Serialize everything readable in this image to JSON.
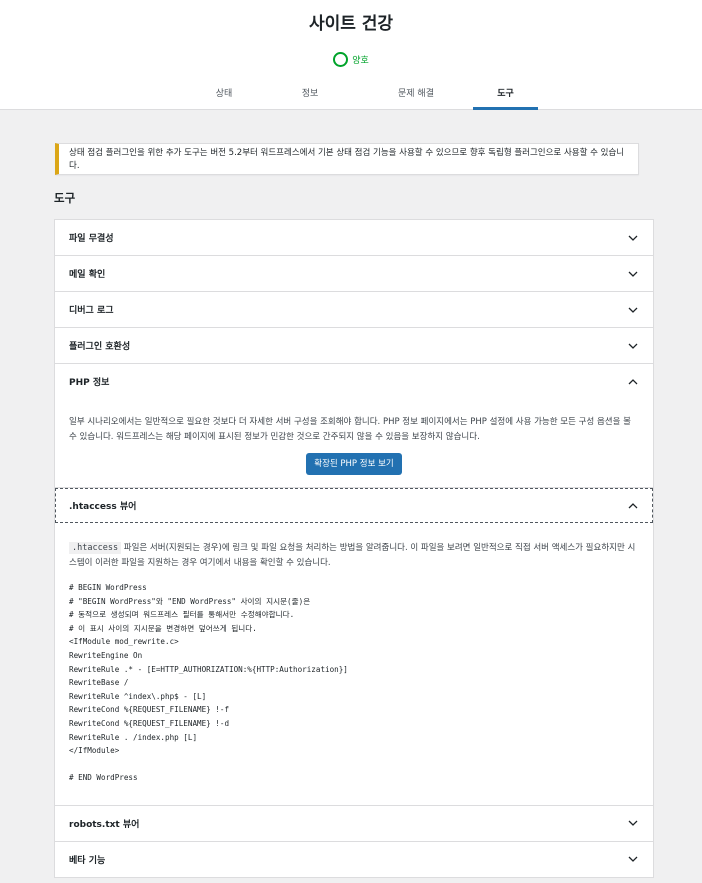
{
  "page": {
    "title": "사이트 건강",
    "status_label": "양호"
  },
  "tabs": [
    {
      "label": "상태"
    },
    {
      "label": "정보"
    },
    {
      "label": "문제 해결"
    },
    {
      "label": "도구"
    }
  ],
  "notice": {
    "text": "상태 점검 플러그인을 위한 추가 도구는 버전 5.2부터 워드프레스에서 기본 상태 점검 기능을 사용할 수 있으므로 향후 독립형 플러그인으로 사용할 수 있습니다."
  },
  "section_title": "도구",
  "accordion": [
    {
      "label": "파일 무결성",
      "expanded": false
    },
    {
      "label": "메일 확인",
      "expanded": false
    },
    {
      "label": "디버그 로그",
      "expanded": false
    },
    {
      "label": "플러그인 호환성",
      "expanded": false
    },
    {
      "label": "PHP 정보",
      "expanded": true
    },
    {
      "label": ".htaccess 뷰어",
      "expanded": true
    },
    {
      "label": "robots.txt 뷰어",
      "expanded": false
    },
    {
      "label": "베타 기능",
      "expanded": false
    }
  ],
  "php_info": {
    "description": "일부 시나리오에서는 일반적으로 필요한 것보다 더 자세한 서버 구성을 조회해야 합니다. PHP 정보 페이지에서는 PHP 설정에 사용 가능한 모든 구성 옵션을 볼 수 있습니다. 워드프레스는 해당 페이지에 표시된 정보가 민감한 것으로 간주되지 않을 수 있음을 보장하지 않습니다.",
    "button_label": "확장된 PHP 정보 보기"
  },
  "htaccess": {
    "filename": ".htaccess",
    "description": " 파일은 서버(지원되는 경우)에 링크 및 파일 요청을 처리하는 방법을 알려줍니다. 이 파일을 보려면 일반적으로 직접 서버 액세스가 필요하지만 시스템이 이러한 파일을 지원하는 경우 여기에서 내용을 확인할 수 있습니다.",
    "code": "# BEGIN WordPress\n# \"BEGIN WordPress\"와 \"END WordPress\" 사이의 지시문(줄)은\n# 동적으로 생성되며 워드프레스 필터를 통해서만 수정해야합니다.\n# 이 표시 사이의 지시문을 변경하면 덮어쓰게 됩니다.\n<IfModule mod_rewrite.c>\nRewriteEngine On\nRewriteRule .* - [E=HTTP_AUTHORIZATION:%{HTTP:Authorization}]\nRewriteBase /\nRewriteRule ^index\\.php$ - [L]\nRewriteCond %{REQUEST_FILENAME} !-f\nRewriteCond %{REQUEST_FILENAME} !-d\nRewriteRule . /index.php [L]\n</IfModule>\n\n# END WordPress"
  },
  "colors": {
    "accent": "#2271b1",
    "good": "#00a32a",
    "notice_border": "#dba617"
  }
}
